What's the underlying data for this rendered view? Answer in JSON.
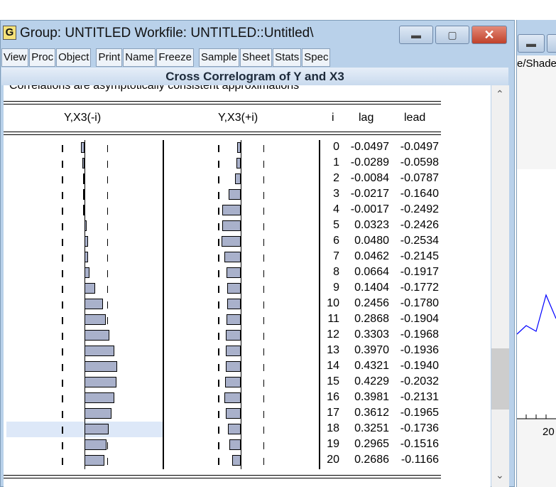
{
  "window": {
    "icon": "G",
    "title": "Group: UNTITLED   Workfile: UNTITLED::Untitled\\"
  },
  "toolbar": [
    "View",
    "Proc",
    "Object",
    "|",
    "Print",
    "Name",
    "Freeze",
    "|",
    "Sample",
    "Sheet",
    "Stats",
    "Spec"
  ],
  "band_title": "Cross Correlogram of Y and X3",
  "note": "Correlations are asymptotically consistent approximations",
  "headers": {
    "left": "Y,X3(-i)",
    "right": "Y,X3(+i)",
    "i": "i",
    "lag": "lag",
    "lead": "lead"
  },
  "rows": [
    {
      "i": "0",
      "lag": "-0.0497",
      "lead": "-0.0497"
    },
    {
      "i": "1",
      "lag": "-0.0289",
      "lead": "-0.0598"
    },
    {
      "i": "2",
      "lag": "-0.0084",
      "lead": "-0.0787"
    },
    {
      "i": "3",
      "lag": "-0.0217",
      "lead": "-0.1640"
    },
    {
      "i": "4",
      "lag": "-0.0017",
      "lead": "-0.2492"
    },
    {
      "i": "5",
      "lag": "0.0323",
      "lead": "-0.2426"
    },
    {
      "i": "6",
      "lag": "0.0480",
      "lead": "-0.2534"
    },
    {
      "i": "7",
      "lag": "0.0462",
      "lead": "-0.2145"
    },
    {
      "i": "8",
      "lag": "0.0664",
      "lead": "-0.1917"
    },
    {
      "i": "9",
      "lag": "0.1404",
      "lead": "-0.1772"
    },
    {
      "i": "10",
      "lag": "0.2456",
      "lead": "-0.1780"
    },
    {
      "i": "11",
      "lag": "0.2868",
      "lead": "-0.1904"
    },
    {
      "i": "12",
      "lag": "0.3303",
      "lead": "-0.1968"
    },
    {
      "i": "13",
      "lag": "0.3970",
      "lead": "-0.1936"
    },
    {
      "i": "14",
      "lag": "0.4321",
      "lead": "-0.1940"
    },
    {
      "i": "15",
      "lag": "0.4229",
      "lead": "-0.2032"
    },
    {
      "i": "16",
      "lag": "0.3981",
      "lead": "-0.2131"
    },
    {
      "i": "17",
      "lag": "0.3612",
      "lead": "-0.1965"
    },
    {
      "i": "18",
      "lag": "0.3251",
      "lead": "-0.1736"
    },
    {
      "i": "19",
      "lag": "0.2965",
      "lead": "-0.1516"
    },
    {
      "i": "20",
      "lag": "0.2686",
      "lead": "-0.1166"
    }
  ],
  "selected_row": 18,
  "conf_bound": 0.3,
  "right_window": {
    "menu_fragment": "e/Shade",
    "axis_label": "20"
  },
  "colors": {
    "bar": "#a9b1cb",
    "highlight": "#dde8f8",
    "line": "#0000ff"
  }
}
